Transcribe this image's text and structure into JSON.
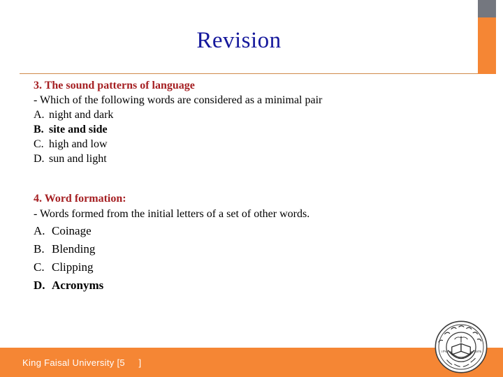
{
  "slide": {
    "title": "Revision",
    "title_color": "#15189c",
    "accent_orange": "#f58634",
    "accent_gray": "#74777f",
    "heading_red": "#a51f22"
  },
  "questions": [
    {
      "heading": "3. The sound patterns of language",
      "stem": "- Which of the following words are considered as a minimal pair",
      "options": [
        {
          "letter": "A.",
          "text": "night and dark",
          "correct": false
        },
        {
          "letter": "B.",
          "text": "site and side",
          "correct": true
        },
        {
          "letter": "C.",
          "text": "high and low",
          "correct": false
        },
        {
          "letter": "D.",
          "text": "sun and light",
          "correct": false
        }
      ]
    },
    {
      "heading": "4. Word formation:",
      "stem": "- Words formed from the initial letters of a set of other words.",
      "options": [
        {
          "letter": "A.",
          "text": "Coinage",
          "correct": false
        },
        {
          "letter": "B.",
          "text": "Blending",
          "correct": false
        },
        {
          "letter": "C.",
          "text": "Clipping",
          "correct": false
        },
        {
          "letter": "D.",
          "text": "Acronyms",
          "correct": true
        }
      ]
    }
  ],
  "footer": {
    "text": "King Faisal University [5     ]",
    "bar_color": "#f58634",
    "text_color": "#ffffff"
  },
  "logo": {
    "name": "king-faisal-university-seal",
    "alt": "King Faisal University seal"
  }
}
